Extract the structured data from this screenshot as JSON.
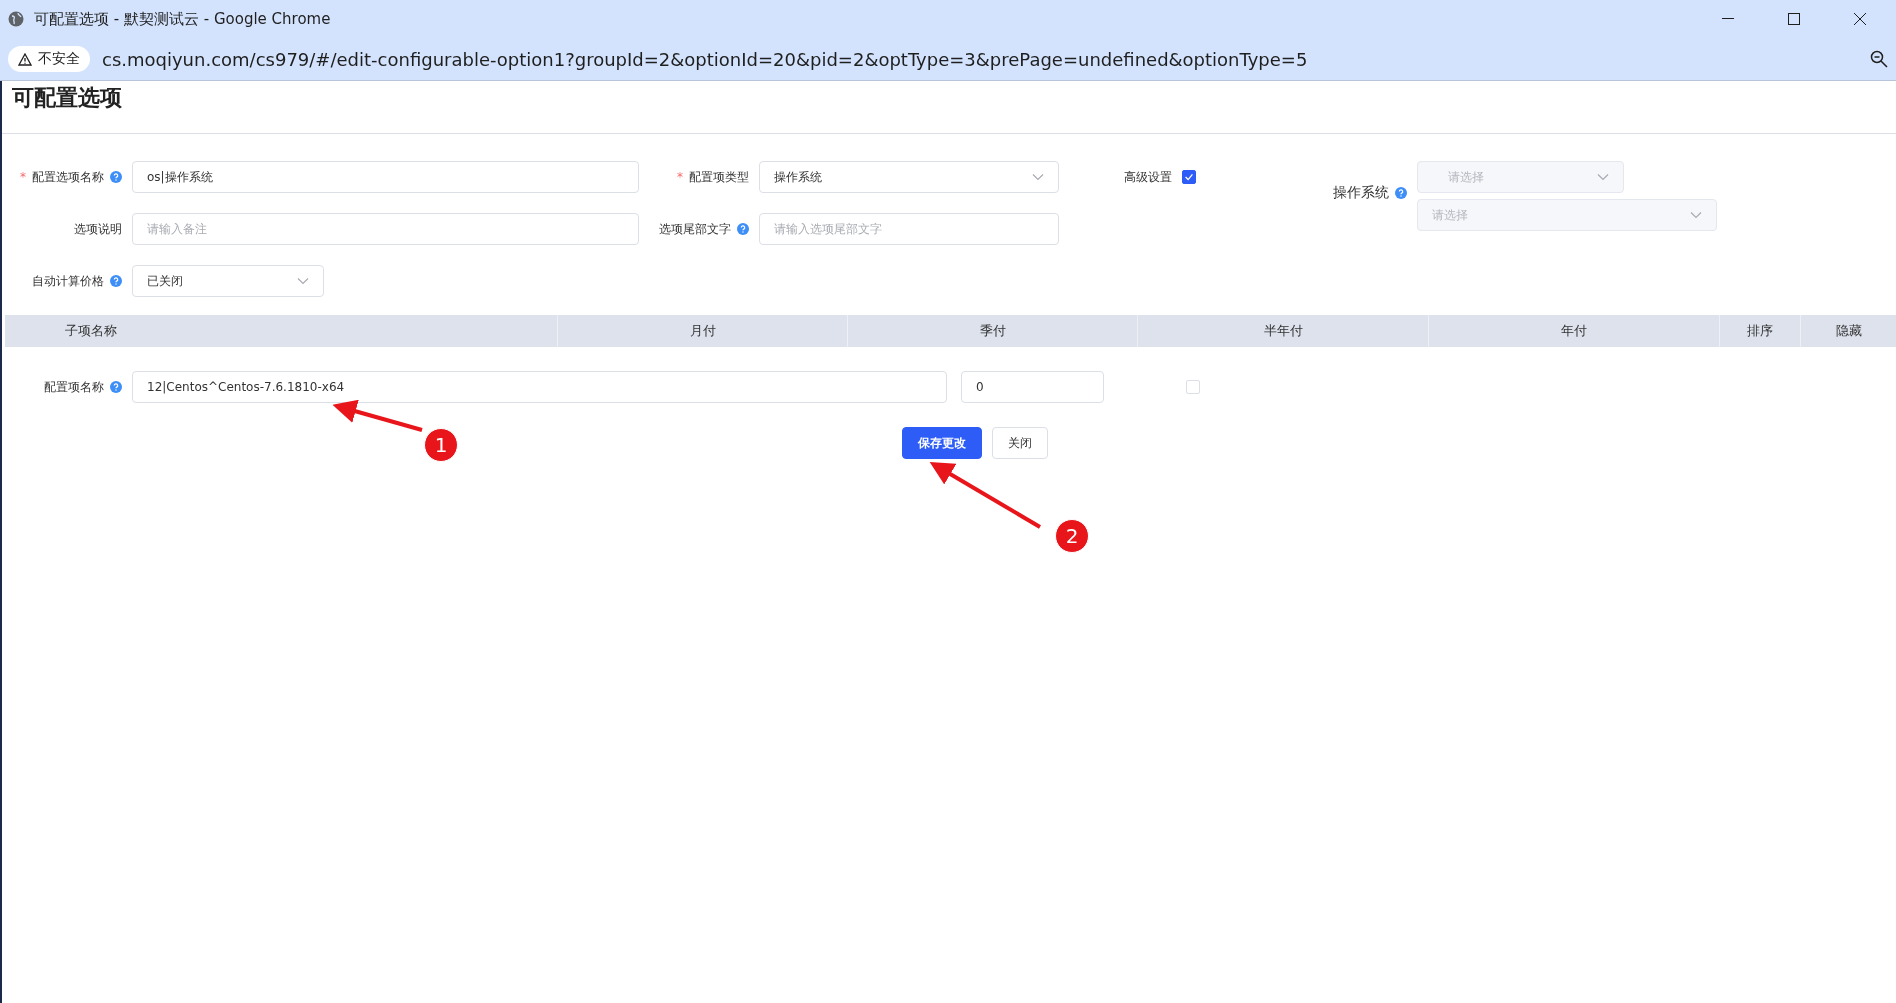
{
  "window": {
    "title": "可配置选项 - 默契测试云 - Google Chrome",
    "security_label": "不安全",
    "url": "cs.moqiyun.com/cs979/#/edit-configurable-option1?groupId=2&optionId=20&pid=2&optType=3&prePage=undefined&optionType=5"
  },
  "page_title": "可配置选项",
  "form_rows": [
    [
      {
        "kind": "text",
        "required_mark": "*",
        "label": "配置选项名称",
        "help": true,
        "value": "os|操作系统"
      },
      {
        "kind": "select",
        "required_mark": "*",
        "label": "配置项类型",
        "help": false,
        "value": "操作系统"
      },
      {
        "kind": "checkbox",
        "label": "高级设置",
        "help": false,
        "checked": true
      },
      {
        "kind": "select-group",
        "label": "操作系统",
        "help": true,
        "selects": [
          {
            "placeholder": "请选择",
            "disabled": true
          },
          {
            "placeholder": "请选择",
            "disabled": true
          }
        ]
      }
    ],
    [
      {
        "kind": "text",
        "label": "选项说明",
        "help": false,
        "placeholder": "请输入备注"
      },
      {
        "kind": "text",
        "label": "选项尾部文字",
        "help": true,
        "placeholder": "请输入选项尾部文字"
      }
    ],
    [
      {
        "kind": "select",
        "label": "自动计算价格",
        "help": true,
        "value": "已关闭"
      }
    ]
  ],
  "table": {
    "columns": [
      "子项名称",
      "月付",
      "季付",
      "半年付",
      "年付",
      "排序",
      "隐藏"
    ],
    "rows": [
      {
        "label": "配置项名称",
        "help": true,
        "name": "12|Centos^Centos-7.6.1810-x64",
        "monthly": "0",
        "hidden": false
      }
    ]
  },
  "buttons": [
    {
      "label": "保存更改",
      "kind": "primary"
    },
    {
      "label": "关闭",
      "kind": "default"
    }
  ],
  "annotations": [
    {
      "label": "1"
    },
    {
      "label": "2"
    }
  ]
}
